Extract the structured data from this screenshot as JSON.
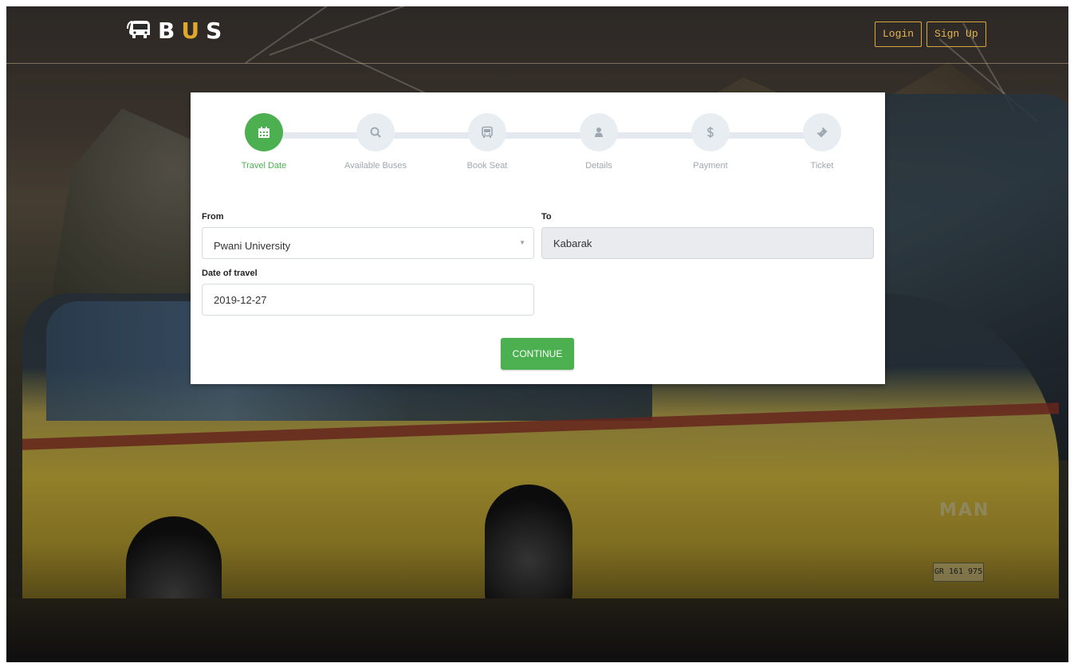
{
  "brand": {
    "prefix": "B",
    "accent": "U",
    "suffix": "S",
    "accent_color": "#e0a82a",
    "icon": "bus-logo-icon"
  },
  "nav": {
    "login_label": "Login",
    "signup_label": "Sign Up",
    "button_color": "#d9a640"
  },
  "steps": [
    {
      "label": "Travel Date",
      "icon": "calendar-icon",
      "active": true
    },
    {
      "label": "Available Buses",
      "icon": "search-icon",
      "active": false
    },
    {
      "label": "Book Seat",
      "icon": "bus-icon",
      "active": false
    },
    {
      "label": "Details",
      "icon": "user-icon",
      "active": false
    },
    {
      "label": "Payment",
      "icon": "dollar-icon",
      "active": false
    },
    {
      "label": "Ticket",
      "icon": "ticket-icon",
      "active": false
    }
  ],
  "form": {
    "from_label": "From",
    "from_value": "Pwani University",
    "to_label": "To",
    "to_value": "Kabarak",
    "date_label": "Date of travel",
    "date_value": "2019-12-27",
    "continue_label": "CONTINUE"
  },
  "background": {
    "vehicle_badge": "MAN",
    "plate_text": "GR 161 975"
  },
  "colors": {
    "active_green": "#4cb050",
    "inactive_step": "#e8edf1",
    "readonly_field": "#e9ebee"
  }
}
